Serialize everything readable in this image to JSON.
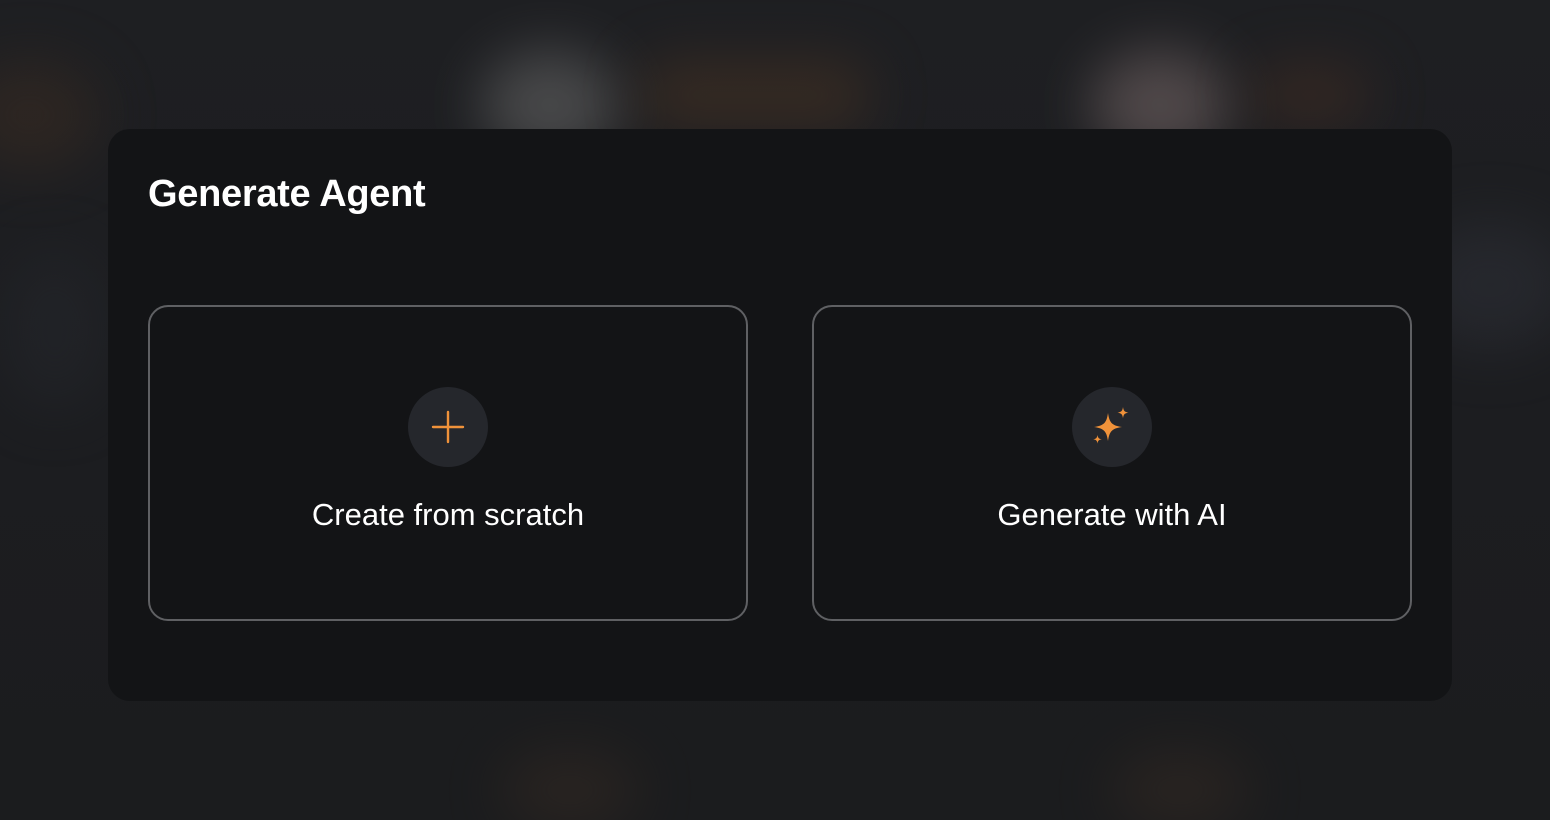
{
  "modal": {
    "title": "Generate Agent",
    "options": [
      {
        "label": "Create from scratch",
        "icon": "plus-icon"
      },
      {
        "label": "Generate with AI",
        "icon": "sparkles-icon"
      }
    ]
  },
  "colors": {
    "accent": "#f0923a",
    "modal_background": "#131416",
    "card_border": "#5f6063",
    "icon_circle": "#25272c",
    "text": "#ffffff"
  }
}
